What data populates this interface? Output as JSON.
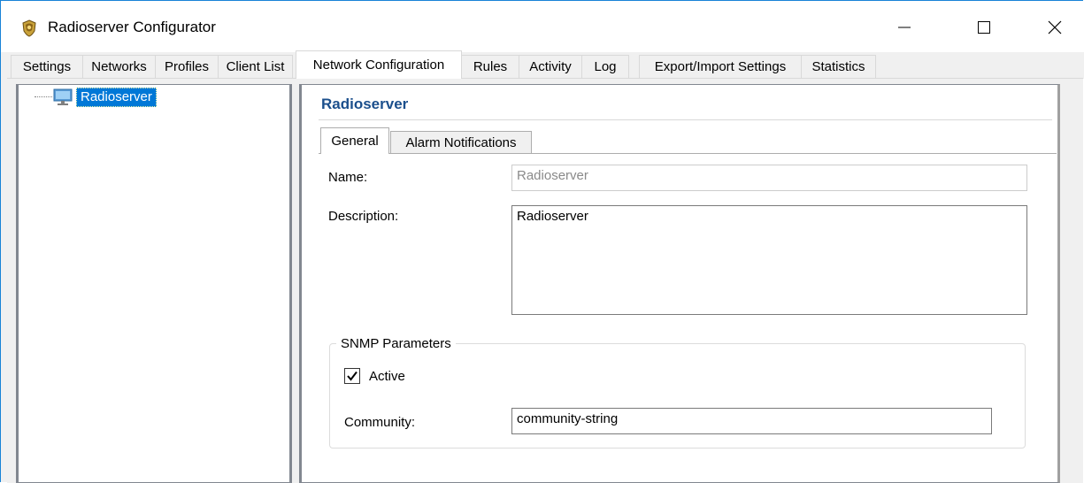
{
  "window": {
    "title": "Radioserver Configurator"
  },
  "tabs": [
    {
      "label": "Settings"
    },
    {
      "label": "Networks"
    },
    {
      "label": "Profiles"
    },
    {
      "label": "Client List"
    },
    {
      "label": "Network Configuration"
    },
    {
      "label": "Rules"
    },
    {
      "label": "Activity"
    },
    {
      "label": "Log"
    },
    {
      "label": "Export/Import Settings"
    },
    {
      "label": "Statistics"
    }
  ],
  "active_tab": "Network Configuration",
  "tree": {
    "items": [
      {
        "label": "Radioserver",
        "icon": "monitor-icon",
        "selected": true
      }
    ]
  },
  "panel": {
    "title": "Radioserver",
    "tabs": [
      {
        "label": "General"
      },
      {
        "label": "Alarm Notifications"
      }
    ],
    "active_tab": "General",
    "name_label": "Name:",
    "name_value": "Radioserver",
    "description_label": "Description:",
    "description_value": "Radioserver",
    "snmp": {
      "group_title": "SNMP Parameters",
      "active_label": "Active",
      "active_checked": true,
      "community_label": "Community:",
      "community_value": "community-string"
    }
  },
  "colors": {
    "accent": "#0078d7",
    "panel_title": "#1b4f8c",
    "window_border": "#1883d7"
  }
}
